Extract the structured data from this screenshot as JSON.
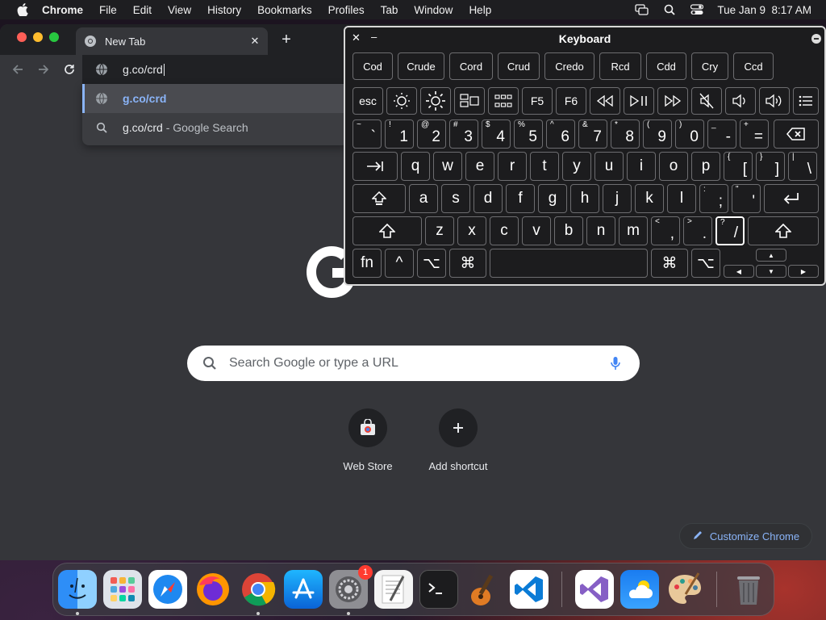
{
  "menubar": {
    "app_name": "Chrome",
    "items": [
      "File",
      "Edit",
      "View",
      "History",
      "Bookmarks",
      "Profiles",
      "Tab",
      "Window",
      "Help"
    ],
    "datetime": "Tue Jan 9  8:17 AM"
  },
  "browser": {
    "tab_title": "New Tab",
    "address_value": "g.co/crd",
    "suggestions": [
      {
        "text": "g.co/crd",
        "suffix": ""
      },
      {
        "text": "g.co/crd",
        "suffix": " - Google Search"
      }
    ],
    "search_placeholder": "Search Google or type a URL",
    "shortcuts": [
      {
        "label": "Web Store"
      },
      {
        "label": "Add shortcut"
      }
    ],
    "customize_label": "Customize Chrome"
  },
  "keyboard_viewer": {
    "title": "Keyboard",
    "suggestions": [
      "Cod",
      "Crude",
      "Cord",
      "Crud",
      "Credo",
      "Rcd",
      "Cdd",
      "Cry",
      "Ccd"
    ],
    "fn_row": {
      "esc": "esc",
      "f5": "F5",
      "f6": "F6"
    },
    "number_row": [
      {
        "top": "~",
        "bottom": "`"
      },
      {
        "top": "!",
        "bottom": "1"
      },
      {
        "top": "@",
        "bottom": "2"
      },
      {
        "top": "#",
        "bottom": "3"
      },
      {
        "top": "$",
        "bottom": "4"
      },
      {
        "top": "%",
        "bottom": "5"
      },
      {
        "top": "^",
        "bottom": "6"
      },
      {
        "top": "&",
        "bottom": "7"
      },
      {
        "top": "*",
        "bottom": "8"
      },
      {
        "top": "(",
        "bottom": "9"
      },
      {
        "top": ")",
        "bottom": "0"
      },
      {
        "top": "_",
        "bottom": "-"
      },
      {
        "top": "+",
        "bottom": "="
      }
    ],
    "row_q": [
      "q",
      "w",
      "e",
      "r",
      "t",
      "y",
      "u",
      "i",
      "o",
      "p"
    ],
    "row_q_symbols": [
      {
        "top": "{",
        "bottom": "["
      },
      {
        "top": "}",
        "bottom": "]"
      },
      {
        "top": "|",
        "bottom": "\\"
      }
    ],
    "row_a": [
      "a",
      "s",
      "d",
      "f",
      "g",
      "h",
      "j",
      "k",
      "l"
    ],
    "row_a_symbols": [
      {
        "top": ":",
        "bottom": ";"
      },
      {
        "top": "\"",
        "bottom": "'"
      }
    ],
    "row_z": [
      "z",
      "x",
      "c",
      "v",
      "b",
      "n",
      "m"
    ],
    "row_z_symbols": [
      {
        "top": "<",
        "bottom": ","
      },
      {
        "top": ">",
        "bottom": "."
      },
      {
        "top": "?",
        "bottom": "/"
      }
    ],
    "bottom_row": {
      "fn": "fn",
      "ctrl": "^",
      "opt": "⌥",
      "cmd": "⌘"
    }
  },
  "dock": {
    "settings_badge": "1"
  },
  "colors": {
    "accent": "#8ab4f8",
    "toolbar": "#35363a",
    "tabstrip": "#202124",
    "keyboard_bg": "#1c1c1e"
  }
}
